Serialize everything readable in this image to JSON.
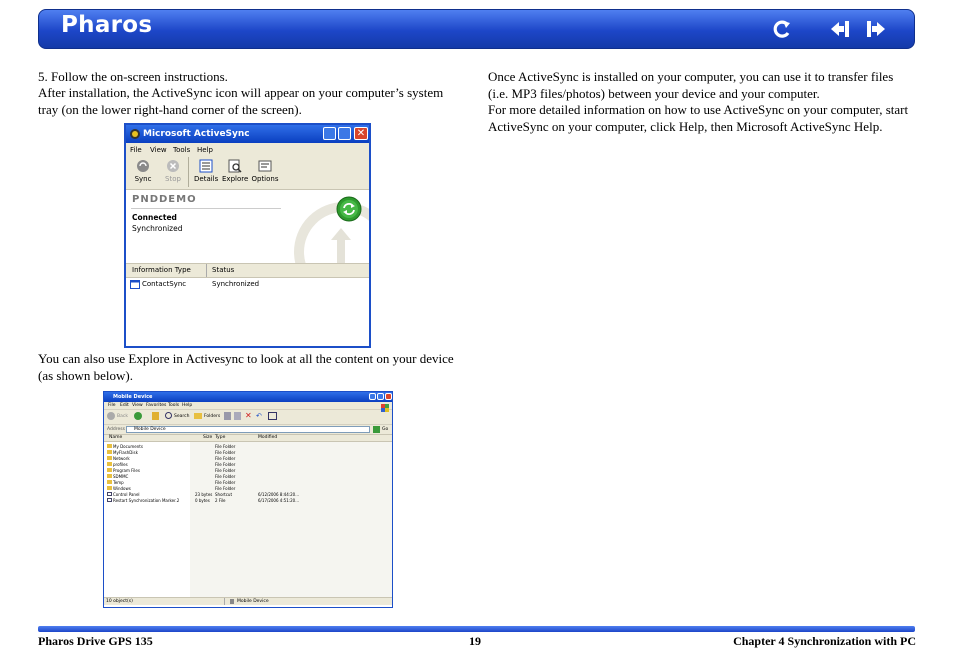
{
  "header": {
    "title": "Pharos"
  },
  "left": {
    "step": "5.   Follow the on-screen instructions.",
    "para1": "After installation, the ActiveSync icon will appear on your computer’s system tray (on the lower right-hand corner of the screen).",
    "para2": "You can also use Explore in Activesync to look at all the content on your device (as shown below)."
  },
  "right": {
    "para1": "Once ActiveSync is installed on your computer, you can use it to transfer files (i.e. MP3 files/photos) between your device and your computer.",
    "para2": "For more detailed information on how to use ActiveSync on your computer, start ActiveSync on your computer, click Help, then Microsoft ActiveSync Help."
  },
  "activesync": {
    "title": "Microsoft ActiveSync",
    "menu": [
      "File",
      "View",
      "Tools",
      "Help"
    ],
    "toolbar": [
      "Sync",
      "Stop",
      "Details",
      "Explore",
      "Options"
    ],
    "device": "PNDDEMO",
    "status1": "Connected",
    "status2": "Synchronized",
    "col_type": "Information Type",
    "col_status": "Status",
    "row_type": "ContactSync",
    "row_status": "Synchronized"
  },
  "explorer": {
    "title": "Mobile Device",
    "menu": [
      "File",
      "Edit",
      "View",
      "Favorites",
      "Tools",
      "Help"
    ],
    "toolbar": {
      "back": "Back",
      "search": "Search",
      "folders": "Folders"
    },
    "address_label": "Address",
    "address_value": "Mobile Device",
    "go": "Go",
    "cols": [
      "Name",
      "Size",
      "Type",
      "Modified"
    ],
    "rows": [
      {
        "name": "My Documents",
        "size": "",
        "type": "File Folder",
        "modified": ""
      },
      {
        "name": "MyFlashDisk",
        "size": "",
        "type": "File Folder",
        "modified": ""
      },
      {
        "name": "Network",
        "size": "",
        "type": "File Folder",
        "modified": ""
      },
      {
        "name": "profiles",
        "size": "",
        "type": "File Folder",
        "modified": ""
      },
      {
        "name": "Program Files",
        "size": "",
        "type": "File Folder",
        "modified": ""
      },
      {
        "name": "SDMMC",
        "size": "",
        "type": "File Folder",
        "modified": ""
      },
      {
        "name": "Temp",
        "size": "",
        "type": "File Folder",
        "modified": ""
      },
      {
        "name": "Windows",
        "size": "",
        "type": "File Folder",
        "modified": ""
      },
      {
        "name": "Control Panel",
        "size": "23 bytes",
        "type": "Shortcut",
        "modified": "6/12/2006  8:44:20..."
      },
      {
        "name": "Restart Synchronization Marker.2",
        "size": "0 bytes",
        "type": "2 File",
        "modified": "6/17/2006  4:51:20..."
      }
    ],
    "status_left": "10 object(s)",
    "status_right": "Mobile Device"
  },
  "footer": {
    "left": "Pharos Drive GPS 135",
    "page": "19",
    "right": "Chapter 4 Synchronization with PC"
  }
}
